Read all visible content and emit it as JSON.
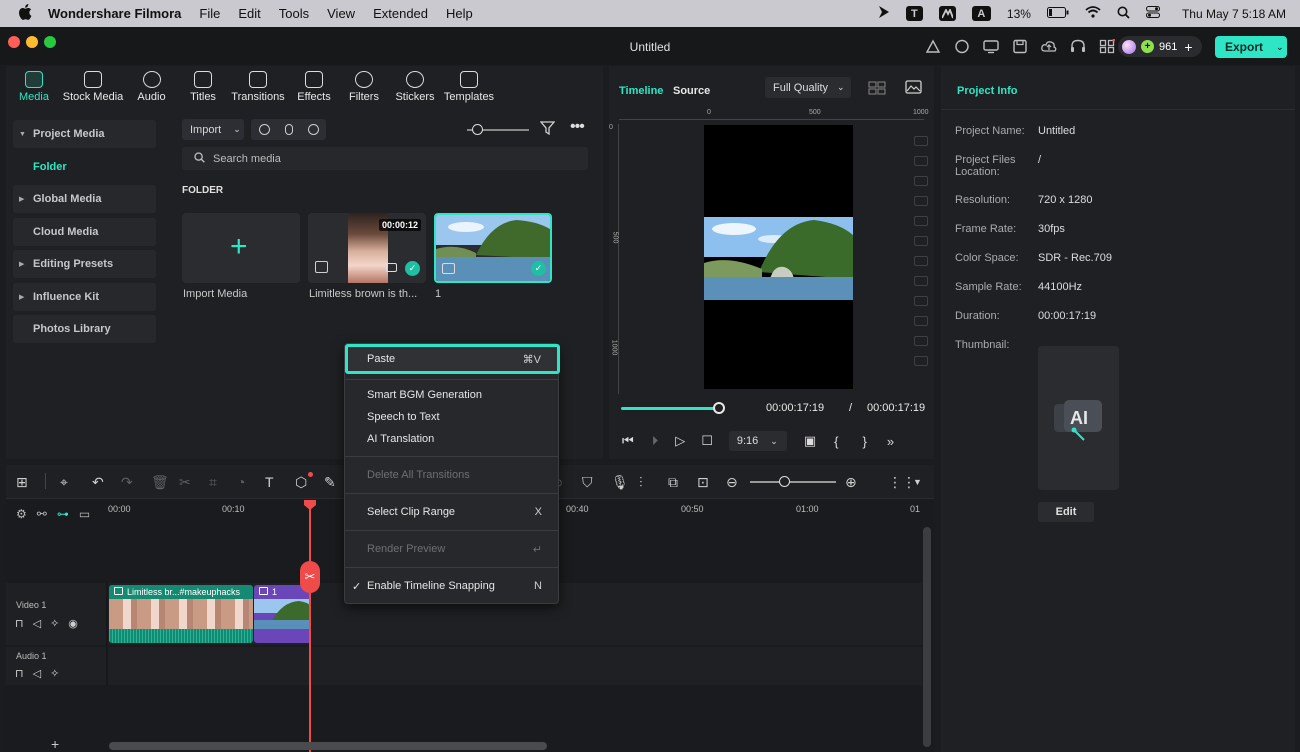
{
  "menubar": {
    "app_name": "Wondershare Filmora",
    "menus": [
      "File",
      "Edit",
      "Tools",
      "View",
      "Extended",
      "Help"
    ],
    "battery": "13%",
    "datetime": "Thu May 7  5:18 AM",
    "status_letters": {
      "t": "T",
      "a": "A"
    }
  },
  "window": {
    "title": "Untitled",
    "credits": "961",
    "export_label": "Export"
  },
  "media_tabs": [
    "Media",
    "Stock Media",
    "Audio",
    "Titles",
    "Transitions",
    "Effects",
    "Filters",
    "Stickers",
    "Templates"
  ],
  "sidebar": {
    "items": [
      {
        "label": "Project Media",
        "caret": "▼"
      },
      {
        "label": "Folder"
      },
      {
        "label": "Global Media",
        "caret": "▶"
      },
      {
        "label": "Cloud Media"
      },
      {
        "label": "Editing Presets",
        "caret": "▶"
      },
      {
        "label": "Influence Kit",
        "caret": "▶"
      },
      {
        "label": "Photos Library"
      }
    ]
  },
  "media": {
    "import_label": "Import",
    "search_placeholder": "Search media",
    "folder_heading": "FOLDER",
    "items": [
      {
        "label": "Import Media"
      },
      {
        "label": "Limitless brown is th...",
        "duration": "00:00:12"
      },
      {
        "label": "1"
      }
    ]
  },
  "preview": {
    "tab_timeline": "Timeline",
    "tab_source": "Source",
    "quality": "Full Quality",
    "ruler_labels": [
      "0",
      "500",
      "1000"
    ],
    "vertical_ruler_labels": [
      "0",
      "500",
      "1000"
    ],
    "current_time": "00:00:17:19",
    "separator": "/",
    "total_time": "00:00:17:19",
    "aspect": "9:16",
    "progress": 1.0
  },
  "project_info": {
    "title": "Project Info",
    "rows": [
      {
        "label": "Project Name:",
        "value": "Untitled"
      },
      {
        "label": "Project Files Location:",
        "value": "/"
      },
      {
        "label": "Resolution:",
        "value": "720 x 1280"
      },
      {
        "label": "Frame Rate:",
        "value": "30fps"
      },
      {
        "label": "Color Space:",
        "value": "SDR - Rec.709"
      },
      {
        "label": "Sample Rate:",
        "value": "44100Hz"
      },
      {
        "label": "Duration:",
        "value": "00:00:17:19"
      },
      {
        "label": "Thumbnail:",
        "value": ""
      }
    ],
    "edit_label": "Edit"
  },
  "timeline": {
    "ruler": [
      "00:00",
      "00:10",
      "00:40",
      "00:50",
      "01:00",
      "01"
    ],
    "tracks": [
      {
        "name": "Video 1"
      },
      {
        "name": "Audio 1"
      }
    ],
    "clips": {
      "video_clip_label": "Limitless br...#makeuphacks",
      "image_clip_label": "1"
    }
  },
  "context_menu": {
    "items": [
      {
        "label": "Paste",
        "shortcut": "⌘V",
        "enabled": true,
        "highlight": true
      },
      {
        "label": "Smart BGM Generation",
        "enabled": true
      },
      {
        "label": "Speech to Text",
        "enabled": true
      },
      {
        "label": "AI Translation",
        "enabled": true
      },
      {
        "label": "Delete All Transitions",
        "enabled": false
      },
      {
        "label": "Select Clip Range",
        "shortcut": "X",
        "enabled": true
      },
      {
        "label": "Render Preview",
        "shortcut": "↵",
        "enabled": false
      },
      {
        "label": "Enable Timeline Snapping",
        "shortcut": "N",
        "enabled": true,
        "checked": true
      }
    ]
  },
  "colors": {
    "accent": "#2ee6c5",
    "playhead": "#ef4b4b",
    "panel_bg": "#1f2023"
  }
}
